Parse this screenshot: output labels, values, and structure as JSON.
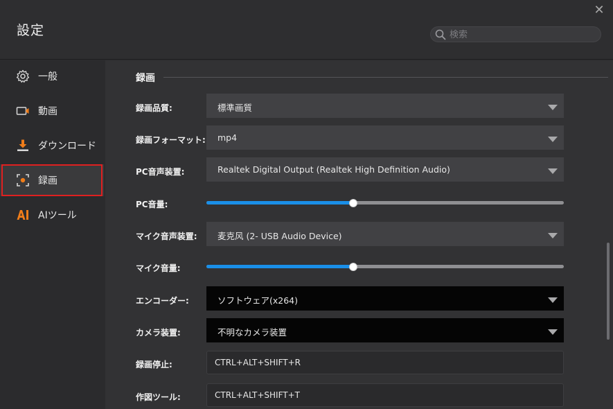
{
  "window": {
    "title": "設定",
    "close_glyph": "✕"
  },
  "search": {
    "placeholder": "検索",
    "value": ""
  },
  "sidebar": {
    "items": [
      {
        "label": "一般",
        "icon": "gear-icon"
      },
      {
        "label": "動画",
        "icon": "video-camera-icon"
      },
      {
        "label": "ダウンロード",
        "icon": "download-icon"
      },
      {
        "label": "録画",
        "icon": "record-target-icon",
        "active": true
      },
      {
        "label": "AIツール",
        "icon": "ai-icon"
      }
    ]
  },
  "section": {
    "title": "録画"
  },
  "settings": {
    "quality": {
      "label": "録画品質:",
      "value": "標準画質"
    },
    "format": {
      "label": "録画フォーマット:",
      "value": "mp4"
    },
    "pc_audio_device": {
      "label": "PC音声装置:",
      "value": "Realtek Digital Output (Realtek High Definition Audio)"
    },
    "pc_volume": {
      "label": "PC音量:",
      "level_percent": 41
    },
    "mic_device": {
      "label": "マイク音声装置:",
      "value": "麦克风 (2- USB Audio Device)"
    },
    "mic_volume": {
      "label": "マイク音量:",
      "level_percent": 41
    },
    "encoder": {
      "label": "エンコーダー:",
      "value": "ソフトウェア(x264)"
    },
    "camera_device": {
      "label": "カメラ装置:",
      "value": "不明なカメラ装置"
    },
    "stop_recording": {
      "label": "録画停止:",
      "value": "CTRL+ALT+SHIFT+R"
    },
    "drawing_tool": {
      "label": "作図ツール:",
      "value": "CTRL+ALT+SHIFT+T"
    }
  },
  "colors": {
    "accent": "#1a8fe8",
    "icon_orange": "#f07d1a",
    "active_outline": "#e02020",
    "background": "#2b2b2d",
    "panel": "#323234"
  }
}
